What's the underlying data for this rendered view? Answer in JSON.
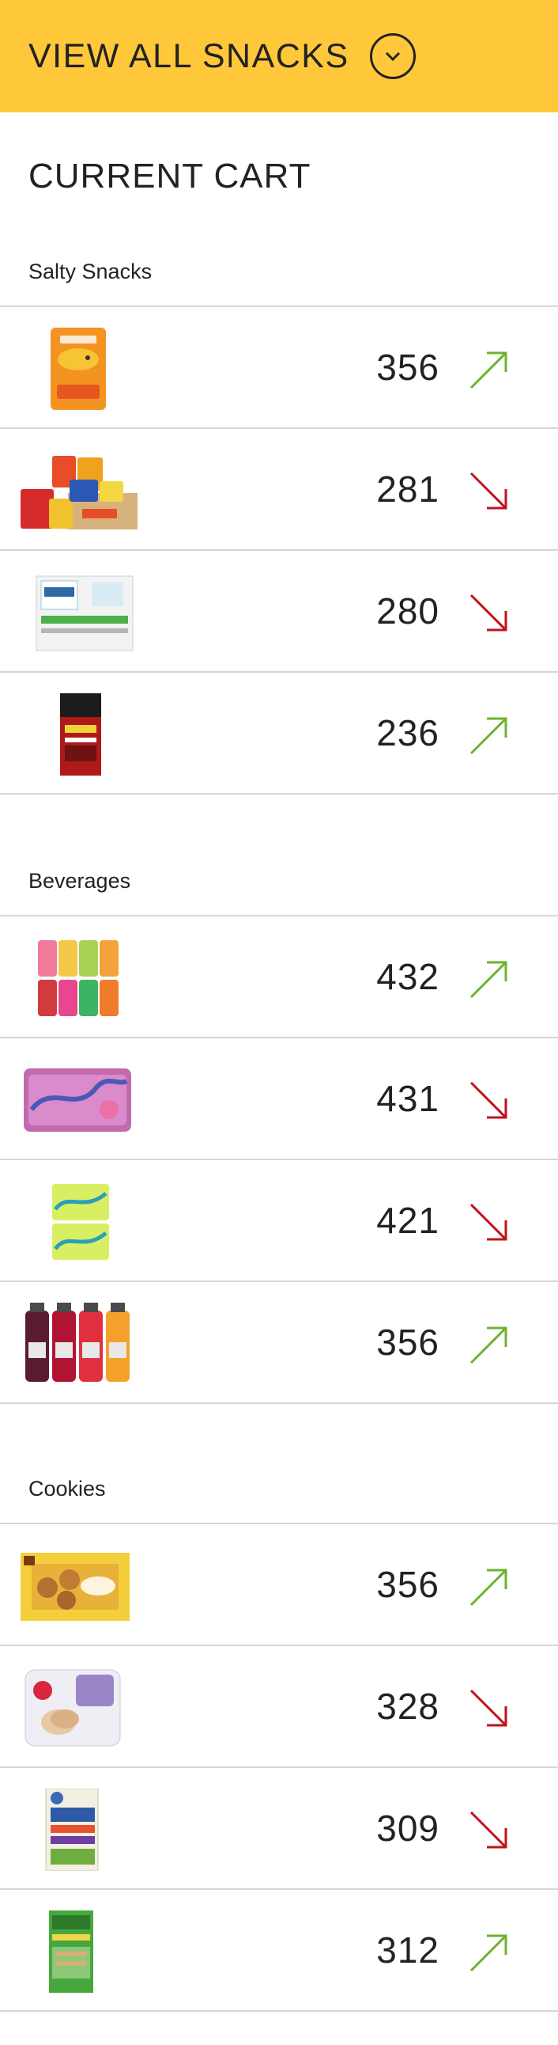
{
  "header": {
    "title": "VIEW ALL SNACKS",
    "toggle_icon": "chevron-down-circle-icon"
  },
  "cart": {
    "title": "CURRENT CART"
  },
  "colors": {
    "up": "#6cb32d",
    "down": "#c1121c",
    "banner": "#ffc83b"
  },
  "sections": [
    {
      "label": "Salty Snacks",
      "items": [
        {
          "product": "goldfish-crackers",
          "count": "356",
          "trend": "up"
        },
        {
          "product": "chips-variety-box",
          "count": "281",
          "trend": "down"
        },
        {
          "product": "cape-cod-chips-box",
          "count": "280",
          "trend": "down"
        },
        {
          "product": "jack-links-jerky",
          "count": "236",
          "trend": "up"
        }
      ]
    },
    {
      "label": "Beverages",
      "items": [
        {
          "product": "sparkling-cans-assorted",
          "count": "432",
          "trend": "up"
        },
        {
          "product": "lacroix-pack-purple",
          "count": "431",
          "trend": "down"
        },
        {
          "product": "lacroix-cans-lime",
          "count": "421",
          "trend": "down"
        },
        {
          "product": "vitaminwater-bottles",
          "count": "356",
          "trend": "up"
        }
      ]
    },
    {
      "label": "Cookies",
      "items": [
        {
          "product": "cookie-box-yellow",
          "count": "356",
          "trend": "up"
        },
        {
          "product": "milano-cookies-tub",
          "count": "328",
          "trend": "down"
        },
        {
          "product": "quaker-chewy-bars",
          "count": "309",
          "trend": "down"
        },
        {
          "product": "granola-bars-green",
          "count": "312",
          "trend": "up"
        }
      ]
    }
  ]
}
